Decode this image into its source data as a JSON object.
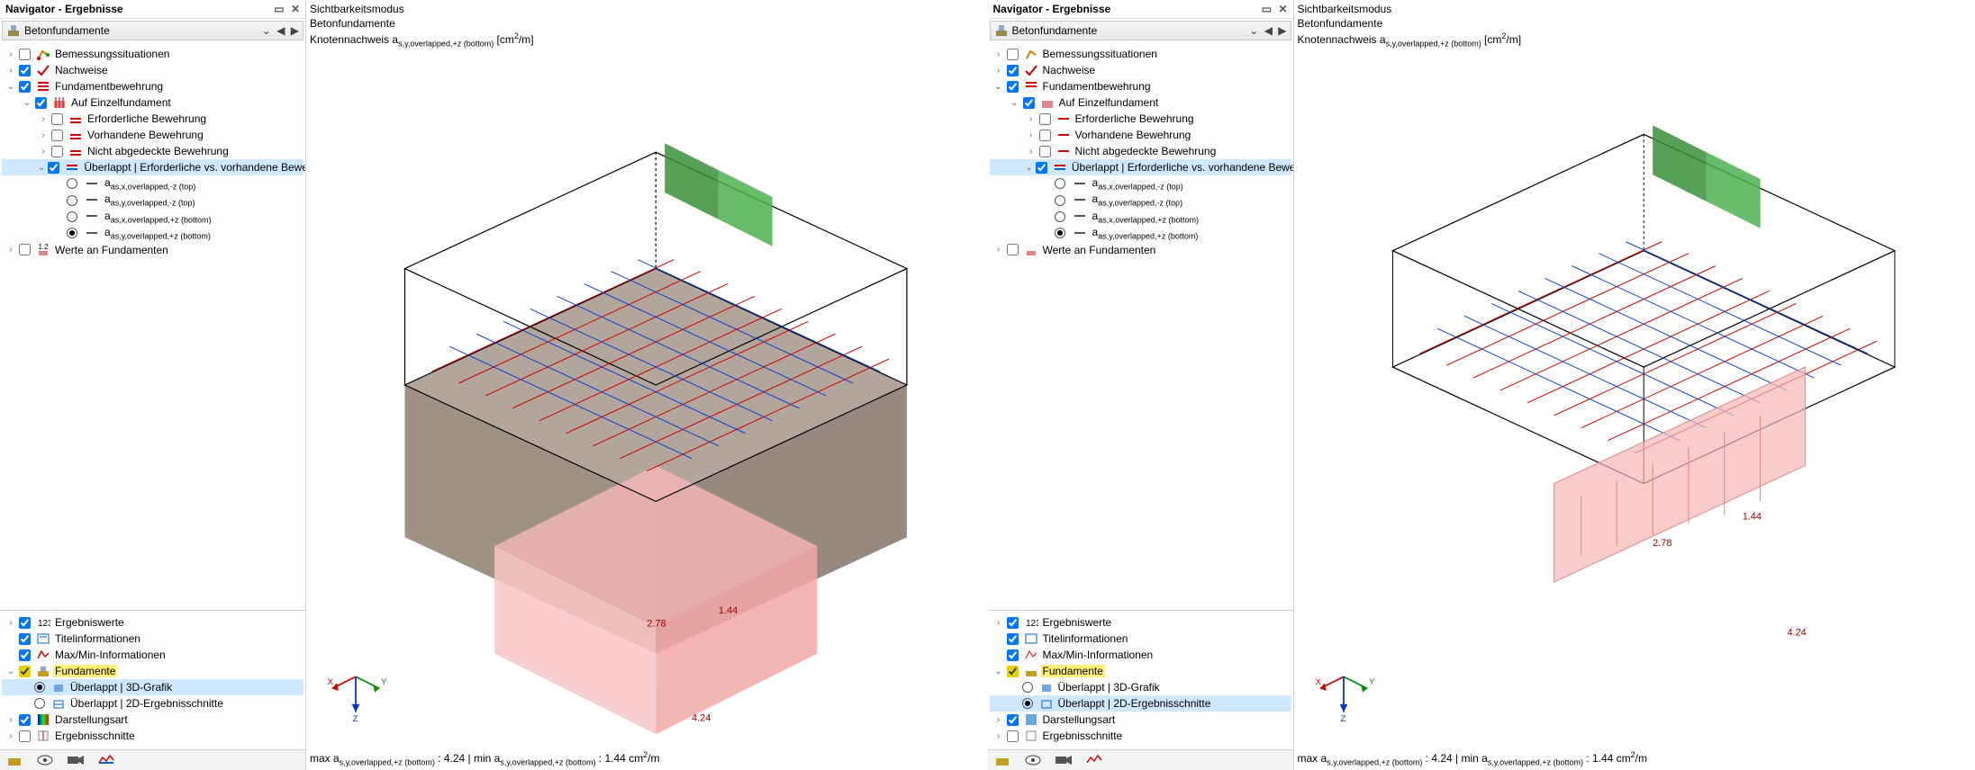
{
  "nav": {
    "title": "Navigator - Ergebnisse",
    "dropdown": "Betonfundamente",
    "tree": {
      "bem": "Bemessungssituationen",
      "nach": "Nachweise",
      "fund": "Fundamentbewehrung",
      "einz": "Auf Einzelfundament",
      "erf": "Erforderliche Bewehrung",
      "vorh": "Vorhandene Bewehrung",
      "nab": "Nicht abgedeckte Bewehrung",
      "ueb": "Überlappt | Erforderliche vs. vorhandene Bewehrung",
      "r1": "as,x,overlapped,-z (top)",
      "r2": "as,y,overlapped,-z (top)",
      "r3": "as,x,overlapped,+z (bottom)",
      "r4": "as,y,overlapped,+z (bottom)",
      "werte": "Werte an Fundamenten"
    },
    "lower": {
      "erg": "Ergebniswerte",
      "titel": "Titelinformationen",
      "mm": "Max/Min-Informationen",
      "fund": "Fundamente",
      "u3d": "Überlappt | 3D-Grafik",
      "u2d": "Überlappt | 2D-Ergebnisschnitte",
      "darst": "Darstellungsart",
      "schn": "Ergebnisschnitte"
    }
  },
  "left": {
    "header": {
      "l1": "Sichtbarkeitsmodus",
      "l2": "Betonfundamente",
      "l3a": "Knotennachweis a",
      "l3b": "s,y,overlapped,+z (bottom)",
      "l3c": " [cm",
      "l3d": "2",
      "l3e": "/m]"
    },
    "status": {
      "maxlbl": "max a",
      "maxsub": "s,y,overlapped,+z (bottom)",
      "maxv": " : 4.24 | ",
      "minlbl": "min a",
      "minsub": "s,y,overlapped,+z (bottom)",
      "minv": " : 1.44 cm",
      "minexp": "2",
      "mintail": "/m"
    },
    "vals": {
      "v1": "2.78",
      "v2": "1.44",
      "v3": "4.24"
    }
  },
  "right": {
    "header": {
      "l1": "Sichtbarkeitsmodus",
      "l2": "Betonfundamente",
      "l3a": "Knotennachweis a",
      "l3b": "s,y,overlapped,+z (bottom)",
      "l3c": " [cm",
      "l3d": "2",
      "l3e": "/m]"
    },
    "status": {
      "maxlbl": "max a",
      "maxsub": "s,y,overlapped,+z (bottom)",
      "maxv": " : 4.24 | ",
      "minlbl": "min a",
      "minsub": "s,y,overlapped,+z (bottom)",
      "minv": " : 1.44 cm",
      "minexp": "2",
      "mintail": "/m"
    },
    "vals": {
      "v1": "2.78",
      "v2": "1.44",
      "v3": "4.24"
    }
  },
  "axis": {
    "x": "X",
    "y": "Y",
    "z": "Z"
  },
  "chart_data": {
    "type": "3d-reinforcement-result",
    "quantity": "a_s,y,overlapped,+z (bottom)",
    "unit": "cm²/m",
    "samples": [
      2.78,
      1.44,
      4.24
    ],
    "max": 4.24,
    "min": 1.44,
    "views": [
      {
        "mode": "Überlappt | 3D-Grafik"
      },
      {
        "mode": "Überlappt | 2D-Ergebnisschnitte"
      }
    ]
  }
}
